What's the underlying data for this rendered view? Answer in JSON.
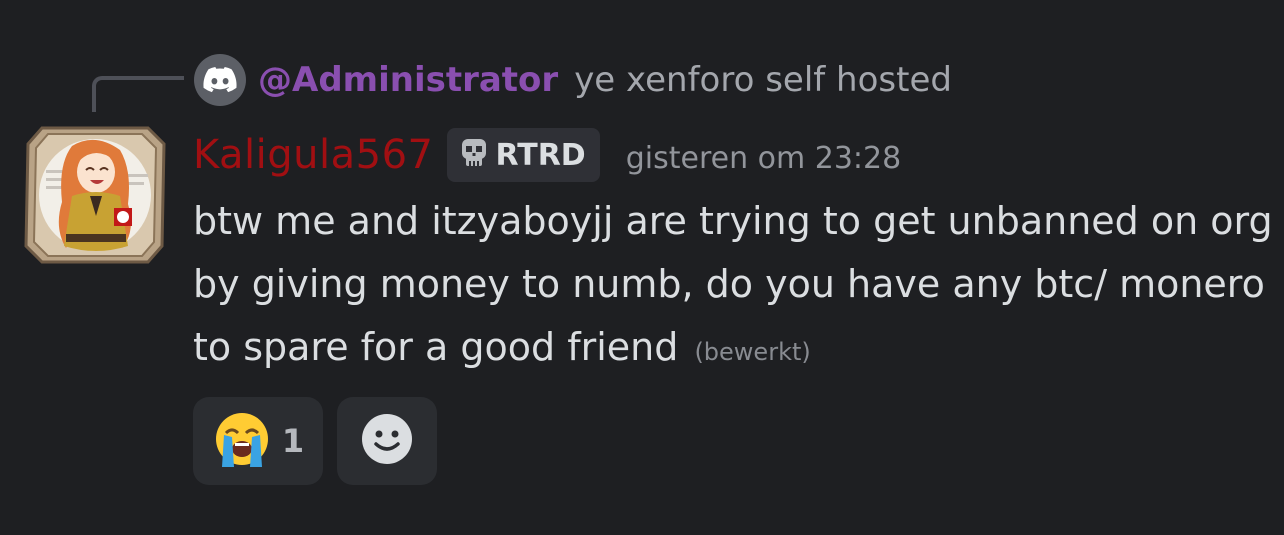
{
  "reply": {
    "mention": "@Administrator",
    "text": "ye xenforo self hosted",
    "avatar_icon": "discord-logo-icon"
  },
  "author": {
    "username": "Kaligula567",
    "username_color": "#a10f12",
    "tag_icon": "skull-icon",
    "tag_label": "RTRD",
    "timestamp": "gisteren om 23:28",
    "avatar": "anime-character-avatar"
  },
  "message": {
    "text": "btw me and itzyaboyjj are trying to get unbanned on org by giving money to numb, do you have any btc/ monero to spare for a good friend",
    "edited_label": "(bewerkt)"
  },
  "reactions": [
    {
      "emoji": "😭",
      "icon": "loudly-crying-face-icon",
      "count": "1"
    }
  ],
  "add_reaction_icon": "add-reaction-smiley-icon"
}
